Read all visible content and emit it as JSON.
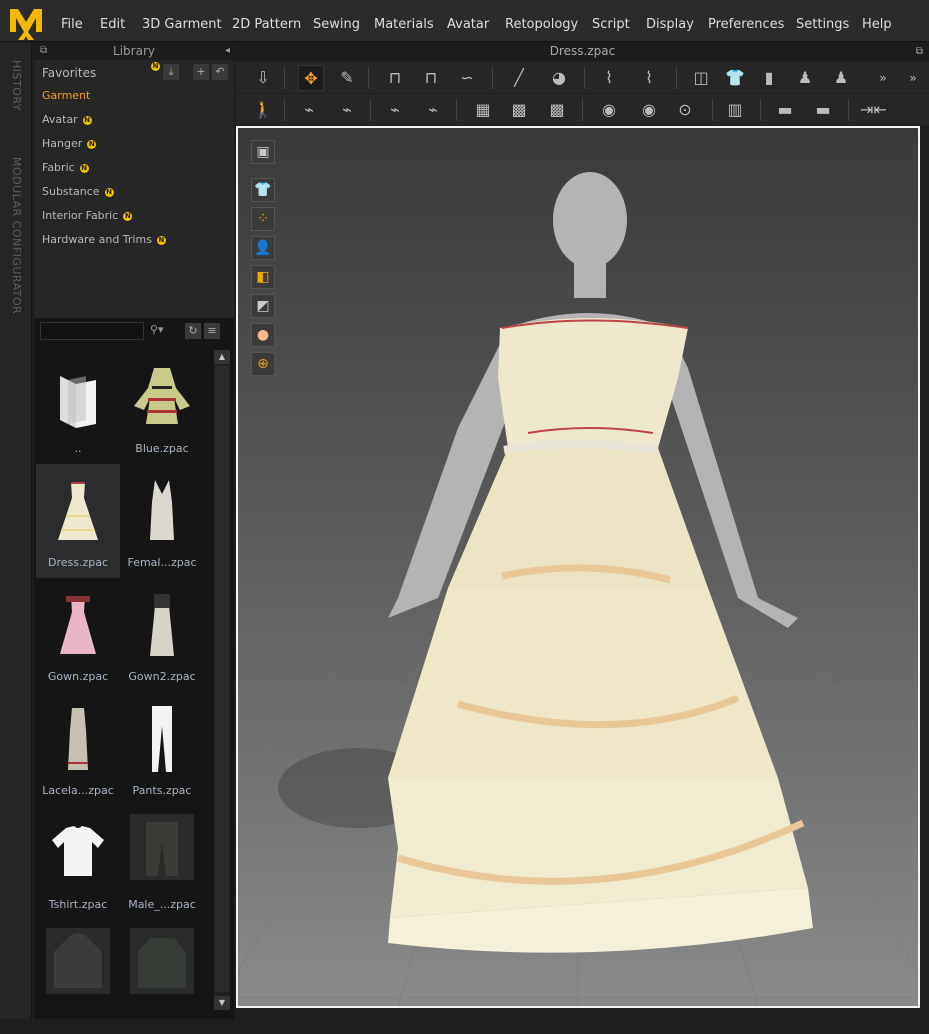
{
  "app": {
    "logo_text": "MD",
    "menu": [
      "File",
      "Edit",
      "3D Garment",
      "2D Pattern",
      "Sewing",
      "Materials",
      "Avatar",
      "Retopology",
      "Script",
      "Display",
      "Preferences",
      "Settings",
      "Help"
    ]
  },
  "side_tabs": [
    "HISTORY",
    "MODULAR CONFIGURATOR"
  ],
  "library": {
    "title": "Library",
    "favorites": "Favorites",
    "categories": [
      {
        "label": "Garment",
        "active": true,
        "new": false
      },
      {
        "label": "Avatar",
        "new": true
      },
      {
        "label": "Hanger",
        "new": true
      },
      {
        "label": "Fabric",
        "new": true
      },
      {
        "label": "Substance",
        "new": true
      },
      {
        "label": "Interior Fabric",
        "new": true
      },
      {
        "label": "Hardware and Trims",
        "new": true
      }
    ],
    "new_badge": "N",
    "accent": "#f0a020",
    "search": {
      "value": "",
      "placeholder": ""
    },
    "files": [
      {
        "name": ".."
      },
      {
        "name": "Blue.zpac"
      },
      {
        "name": "Dress.zpac",
        "selected": true
      },
      {
        "name": "Femal...zpac"
      },
      {
        "name": "Gown.zpac"
      },
      {
        "name": "Gown2.zpac"
      },
      {
        "name": "Lacela...zpac"
      },
      {
        "name": "Pants.zpac"
      },
      {
        "name": "Tshirt.zpac"
      },
      {
        "name": "Male_...zpac"
      },
      {
        "name": ""
      },
      {
        "name": ""
      }
    ]
  },
  "document": {
    "tab_title": "Dress.zpac"
  },
  "toolbar_row1": [
    "drop-down-arrow",
    "transform-move",
    "edit-pin",
    "sewing-segment",
    "sewing-measure",
    "sewing-curve",
    "pin-tool",
    "fold-pin",
    "edit-curve-point",
    "edit-curve",
    "fold-arrange",
    "garment-front",
    "garment-side",
    "avatar-arrange",
    "avatar-measure",
    "more"
  ],
  "toolbar_row2": [
    "avatar-pose",
    "edit-texture-line",
    "draw-texture-line",
    "edit-line",
    "draw-line",
    "puckering",
    "select-graphic",
    "graphic-tool",
    "button-select",
    "button-tool",
    "buttonhole",
    "zipper",
    "trim-select",
    "trim-tool",
    "tack"
  ],
  "viewport_tools": [
    "render-mode",
    "garment-display",
    "points-display",
    "avatar-display",
    "texture-display",
    "shading",
    "avatar-skin",
    "grid-display"
  ]
}
